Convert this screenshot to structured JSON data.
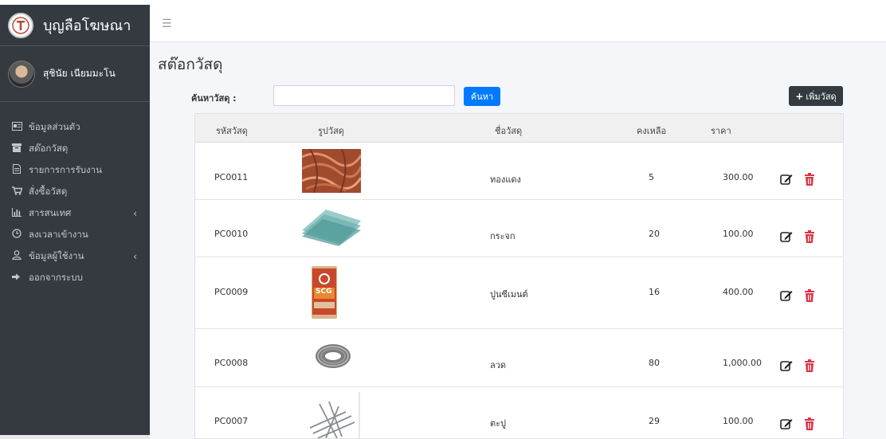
{
  "app": {
    "brand": "บุญลือโฆษณา",
    "user_name": "สุชินัย เนียมมะโน"
  },
  "sidebar": {
    "items": [
      {
        "icon": "id-card-icon",
        "label": "ข้อมูลส่วนตัว"
      },
      {
        "icon": "box-icon",
        "label": "สต๊อกวัสดุ"
      },
      {
        "icon": "document-icon",
        "label": "รายการการรับงาน"
      },
      {
        "icon": "cart-icon",
        "label": "สั่งซื้อวัสดุ"
      },
      {
        "icon": "chart-icon",
        "label": "สารสนเทศ",
        "has_chevron": true
      },
      {
        "icon": "clock-icon",
        "label": "ลงเวลาเข้างาน"
      },
      {
        "icon": "user-icon",
        "label": "ข้อมูลผู้ใช้งาน",
        "has_chevron": true
      },
      {
        "icon": "logout-icon",
        "label": "ออกจากระบบ"
      }
    ]
  },
  "page": {
    "title": "สต๊อกวัสดุ"
  },
  "search": {
    "label": "ค้นหาวัสดุ :",
    "value": "",
    "placeholder": "",
    "button": "ค้นหา"
  },
  "add_button": "เพิ่มวัสดุ",
  "table": {
    "headers": {
      "code": "รหัสวัสดุ",
      "image": "รูปวัสดุ",
      "name": "ชื่อวัสดุ",
      "qty": "คงเหลือ",
      "price": "ราคา"
    },
    "rows": [
      {
        "code": "PC0011",
        "name": "ทองแดง",
        "qty": "5",
        "price": "300.00",
        "image": "copper-wire-image"
      },
      {
        "code": "PC0010",
        "name": "กระจก",
        "qty": "20",
        "price": "100.00",
        "image": "glass-sheets-image"
      },
      {
        "code": "PC0009",
        "name": "ปูนซีเมนต์",
        "qty": "16",
        "price": "400.00",
        "image": "cement-bag-image",
        "image_text": "SCG"
      },
      {
        "code": "PC0008",
        "name": "ลวด",
        "qty": "80",
        "price": "1,000.00",
        "image": "wire-coil-image"
      },
      {
        "code": "PC0007",
        "name": "ตะปู",
        "qty": "29",
        "price": "100.00",
        "image": "nails-image"
      }
    ]
  },
  "colors": {
    "sidebar": "#343a40",
    "primary": "#007bff",
    "danger": "#dc3545"
  }
}
